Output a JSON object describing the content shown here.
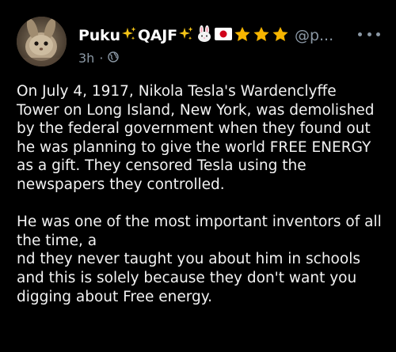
{
  "post": {
    "author": {
      "name": "Puku",
      "name_mid": "QAJF",
      "handle": "@p...",
      "avatar": "rabbit-avatar"
    },
    "meta": {
      "time": "3h",
      "separator": "·",
      "visibility_icon": "globe-icon"
    },
    "menu_icon": "more-horizontal-icon",
    "paragraph1": [
      "On July 4, 1917, Nikola Tesla's Wardenclyffe",
      "Tower on Long Island, New York, was demolished",
      "by the federal government when they found out",
      "he was planning to give the world FREE ENERGY",
      "as a gift. They censored Tesla using the",
      "newspapers they controlled."
    ],
    "paragraph2": [
      "He was one of the most important inventors of all",
      "the time, a",
      "nd they never taught you about him in schools",
      "and this is solely because they don't want you",
      "digging about Free energy."
    ],
    "colors": {
      "background": "#000000",
      "text": "#f2f2f2",
      "muted": "#8b98a5",
      "star": "#f7b500",
      "sparkle": "#f5c518"
    }
  }
}
